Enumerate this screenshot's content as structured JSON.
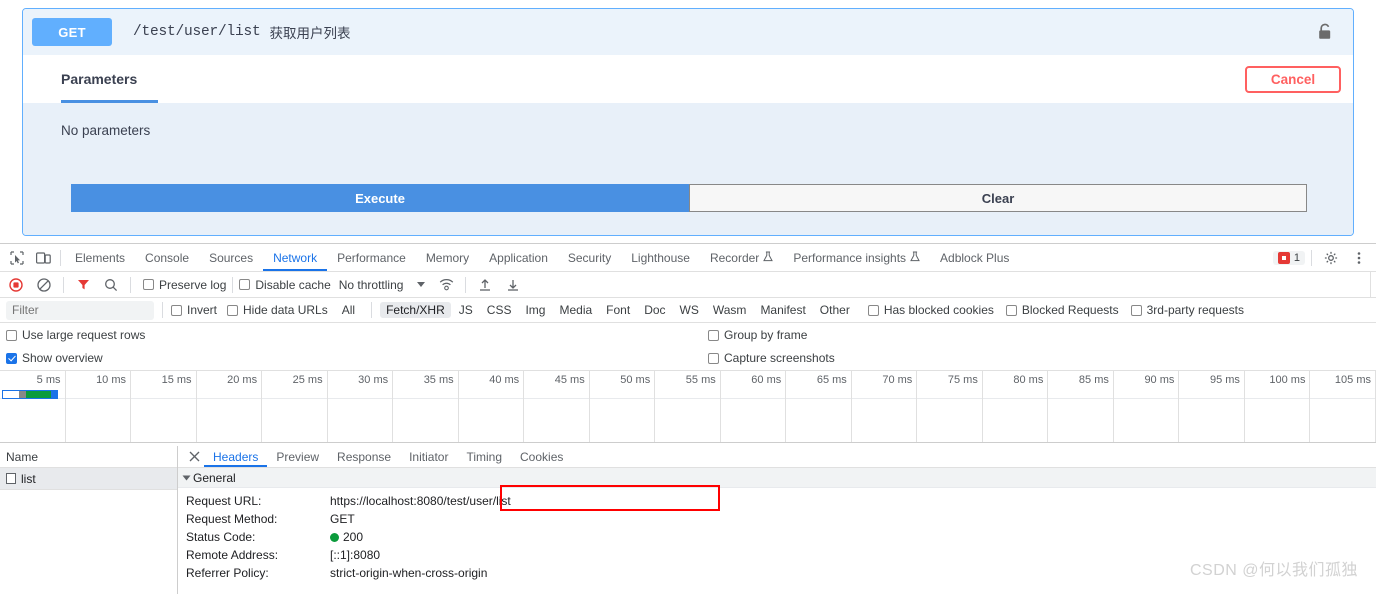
{
  "swagger": {
    "method": "GET",
    "path": "/test/user/list",
    "summary": "获取用户列表",
    "lock_icon": "unlocked-padlock-icon",
    "tab_parameters": "Parameters",
    "cancel_label": "Cancel",
    "no_parameters": "No parameters",
    "execute_label": "Execute",
    "clear_label": "Clear",
    "accent_blue": "#61affe",
    "execute_blue": "#4990e2",
    "cancel_red": "#ff6060"
  },
  "devtools": {
    "tabs": [
      {
        "label": "Elements",
        "active": false,
        "icon": null
      },
      {
        "label": "Console",
        "active": false,
        "icon": null
      },
      {
        "label": "Sources",
        "active": false,
        "icon": null
      },
      {
        "label": "Network",
        "active": true,
        "icon": null
      },
      {
        "label": "Performance",
        "active": false,
        "icon": null
      },
      {
        "label": "Memory",
        "active": false,
        "icon": null
      },
      {
        "label": "Application",
        "active": false,
        "icon": null
      },
      {
        "label": "Security",
        "active": false,
        "icon": null
      },
      {
        "label": "Lighthouse",
        "active": false,
        "icon": null
      },
      {
        "label": "Recorder",
        "active": false,
        "icon": "flask-icon"
      },
      {
        "label": "Performance insights",
        "active": false,
        "icon": "flask-icon"
      },
      {
        "label": "Adblock Plus",
        "active": false,
        "icon": null
      }
    ],
    "left_icons": [
      "inspect-element-icon",
      "device-toolbar-icon"
    ],
    "error_badge": {
      "icon": "error-icon",
      "count": "1"
    },
    "right_icons": [
      "gear-icon",
      "kebab-menu-icon"
    ],
    "netbar": {
      "record_icon": "record-stop-icon",
      "clear_icon": "clear-network-icon",
      "filter_icon": "funnel-filter-icon",
      "search_icon": "search-icon",
      "preserve_log": {
        "label": "Preserve log",
        "checked": false
      },
      "disable_cache": {
        "label": "Disable cache",
        "checked": false
      },
      "throttling": "No throttling",
      "network_conditions_icon": "wifi-network-conditions-icon",
      "import_har_icon": "import-har-icon",
      "export_har_icon": "export-har-icon"
    },
    "filterbar": {
      "filter_value": "",
      "filter_placeholder": "Filter",
      "invert": {
        "label": "Invert",
        "checked": false
      },
      "hide_data_urls": {
        "label": "Hide data URLs",
        "checked": false
      },
      "types": [
        {
          "label": "All",
          "active": false
        },
        {
          "label": "Fetch/XHR",
          "active": true
        },
        {
          "label": "JS",
          "active": false
        },
        {
          "label": "CSS",
          "active": false
        },
        {
          "label": "Img",
          "active": false
        },
        {
          "label": "Media",
          "active": false
        },
        {
          "label": "Font",
          "active": false
        },
        {
          "label": "Doc",
          "active": false
        },
        {
          "label": "WS",
          "active": false
        },
        {
          "label": "Wasm",
          "active": false
        },
        {
          "label": "Manifest",
          "active": false
        },
        {
          "label": "Other",
          "active": false
        }
      ],
      "has_blocked_cookies": {
        "label": "Has blocked cookies",
        "checked": false
      },
      "blocked_requests": {
        "label": "Blocked Requests",
        "checked": false
      },
      "third_party_requests": {
        "label": "3rd-party requests",
        "checked": false
      }
    },
    "settings": {
      "use_large_request_rows": {
        "label": "Use large request rows",
        "checked": false
      },
      "show_overview": {
        "label": "Show overview",
        "checked": true
      },
      "group_by_frame": {
        "label": "Group by frame",
        "checked": false
      },
      "capture_screenshots": {
        "label": "Capture screenshots",
        "checked": false
      }
    },
    "overview": {
      "ticks": [
        "5 ms",
        "10 ms",
        "15 ms",
        "20 ms",
        "25 ms",
        "30 ms",
        "35 ms",
        "40 ms",
        "45 ms",
        "50 ms",
        "55 ms",
        "60 ms",
        "65 ms",
        "70 ms",
        "75 ms",
        "80 ms",
        "85 ms",
        "90 ms",
        "95 ms",
        "100 ms",
        "105 ms"
      ]
    },
    "request_list": {
      "column_name": "Name",
      "rows": [
        {
          "name": "list",
          "icon": "document-icon",
          "selected": true
        }
      ]
    },
    "detail": {
      "close_icon": "close-icon",
      "tabs": [
        {
          "label": "Headers",
          "active": true
        },
        {
          "label": "Preview",
          "active": false
        },
        {
          "label": "Response",
          "active": false
        },
        {
          "label": "Initiator",
          "active": false
        },
        {
          "label": "Timing",
          "active": false
        },
        {
          "label": "Cookies",
          "active": false
        }
      ],
      "section_title": "General",
      "fields": [
        {
          "key": "Request URL:",
          "value": "https://localhost:8080/test/user/list",
          "highlight": true
        },
        {
          "key": "Request Method:",
          "value": "GET",
          "highlight": false
        },
        {
          "key": "Status Code:",
          "value": "200",
          "status_dot": "#0b9b3c",
          "highlight": false
        },
        {
          "key": "Remote Address:",
          "value": "[::1]:8080",
          "highlight": false
        },
        {
          "key": "Referrer Policy:",
          "value": "strict-origin-when-cross-origin",
          "highlight": false
        }
      ],
      "highlight_color": "#ff0000"
    }
  },
  "watermark": "CSDN @何以我们孤独"
}
